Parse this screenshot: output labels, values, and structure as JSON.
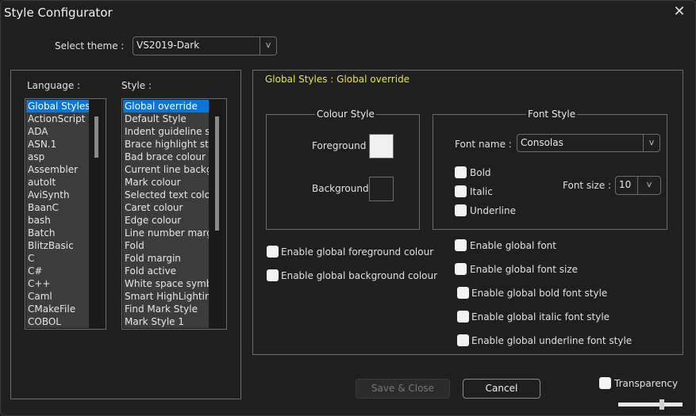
{
  "window": {
    "title": "Style Configurator",
    "close_icon": "close-icon"
  },
  "theme": {
    "label": "Select theme :",
    "value": "VS2019-Dark",
    "arrow": "v"
  },
  "language": {
    "label": "Language :",
    "selected": "Global Styles",
    "items": [
      "Global Styles",
      "ActionScript",
      "ADA",
      "ASN.1",
      "asp",
      "Assembler",
      "autoIt",
      "AviSynth",
      "BaanC",
      "bash",
      "Batch",
      "BlitzBasic",
      "C",
      "C#",
      "C++",
      "Caml",
      "CMakeFile",
      "COBOL"
    ]
  },
  "style": {
    "label": "Style :",
    "selected": "Global override",
    "items": [
      "Global override",
      "Default Style",
      "Indent guideline style",
      "Brace highlight style",
      "Bad brace colour",
      "Current line background colour",
      "Mark colour",
      "Selected text colour",
      "Caret colour",
      "Edge colour",
      "Line number margin",
      "Fold",
      "Fold margin",
      "Fold active",
      "White space symbol",
      "Smart HighLighting",
      "Find Mark Style",
      "Mark Style 1"
    ]
  },
  "panel": {
    "title": "Global Styles : Global override",
    "title_color": "#e6e62e"
  },
  "colour_style": {
    "legend": "Colour Style",
    "foreground_label": "Foreground",
    "foreground_color": "#f0f0f0",
    "background_label": "Background",
    "background_color": "#1f1f1f"
  },
  "font_style": {
    "legend": "Font Style",
    "font_name_label": "Font name :",
    "font_name": "Consolas",
    "bold": "Bold",
    "italic": "Italic",
    "underline": "Underline",
    "font_size_label": "Font size :",
    "font_size": "10",
    "arrow": "v"
  },
  "options": {
    "fg": "Enable global foreground colour",
    "bg": "Enable global background colour",
    "font": "Enable global font",
    "font_size": "Enable global font size",
    "bold": "Enable global bold font style",
    "italic": "Enable global italic font style",
    "underline": "Enable global underline font style"
  },
  "footer": {
    "save": "Save & Close",
    "cancel": "Cancel",
    "transparency": "Transparency",
    "transparency_level": 0.68
  }
}
